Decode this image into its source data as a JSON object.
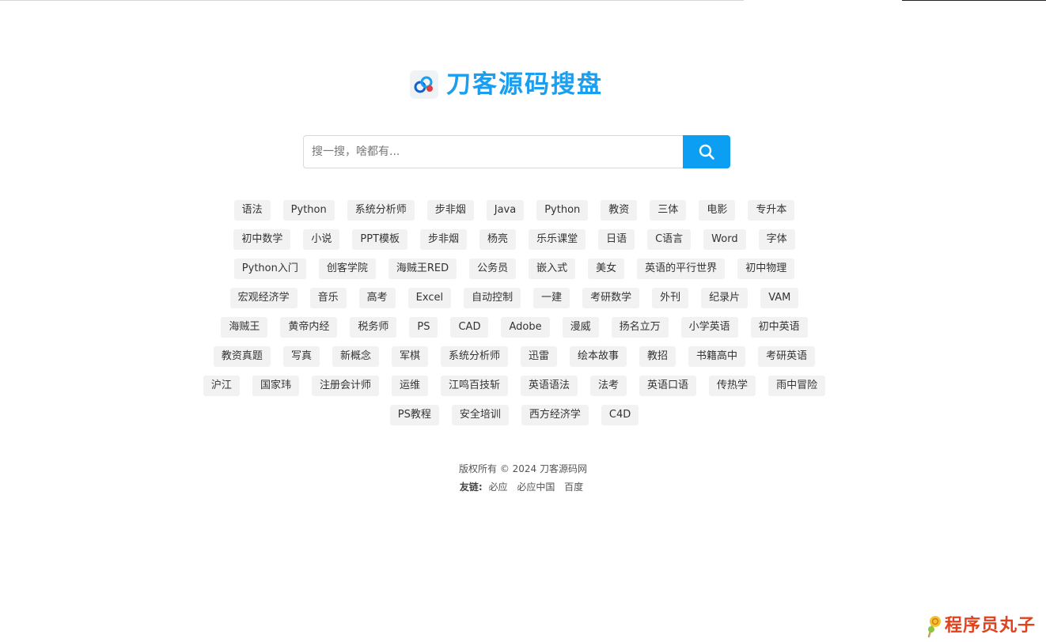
{
  "brand": {
    "logo_text": "刀客源码搜盘"
  },
  "search": {
    "placeholder": "搜一搜，啥都有..."
  },
  "tag_rows": [
    [
      "语法",
      "Python",
      "系统分析师",
      "步非烟",
      "Java",
      "Python",
      "教资",
      "三体",
      "电影",
      "专升本"
    ],
    [
      "初中数学",
      "小说",
      "PPT模板",
      "步非烟",
      "杨亮",
      "乐乐课堂",
      "日语",
      "C语言",
      "Word",
      "字体"
    ],
    [
      "Python入门",
      "创客学院",
      "海贼王RED",
      "公务员",
      "嵌入式",
      "美女",
      "英语的平行世界",
      "初中物理"
    ],
    [
      "宏观经济学",
      "音乐",
      "高考",
      "Excel",
      "自动控制",
      "一建",
      "考研数学",
      "外刊",
      "纪录片",
      "VAM"
    ],
    [
      "海贼王",
      "黄帝内经",
      "税务师",
      "PS",
      "CAD",
      "Adobe",
      "漫威",
      "扬名立万",
      "小学英语",
      "初中英语"
    ],
    [
      "教资真题",
      "写真",
      "新概念",
      "军棋",
      "系统分析师",
      "迅雷",
      "绘本故事",
      "教招",
      "书籍高中",
      "考研英语"
    ],
    [
      "沪江",
      "国家玮",
      "注册会计师",
      "运维",
      "江鸣百技斩",
      "英语语法",
      "法考",
      "英语口语",
      "传热学",
      "雨中冒险"
    ],
    [
      "PS教程",
      "安全培训",
      "西方经济学",
      "C4D"
    ]
  ],
  "footer": {
    "copyright": "版权所有 © 2024 刀客源码网",
    "links_label": "友链:",
    "links": [
      "必应",
      "必应中国",
      "百度"
    ]
  },
  "watermark": {
    "text": "程序员丸子"
  },
  "colors": {
    "brand_blue": "#1a9ef0",
    "search_button": "#0b9ef3",
    "tag_bg": "#f2f2f2",
    "watermark": "#e0421d"
  },
  "icons": {
    "logo": "cloud-link-logo-icon",
    "search": "search-icon",
    "watermark": "lollipop-icon"
  }
}
